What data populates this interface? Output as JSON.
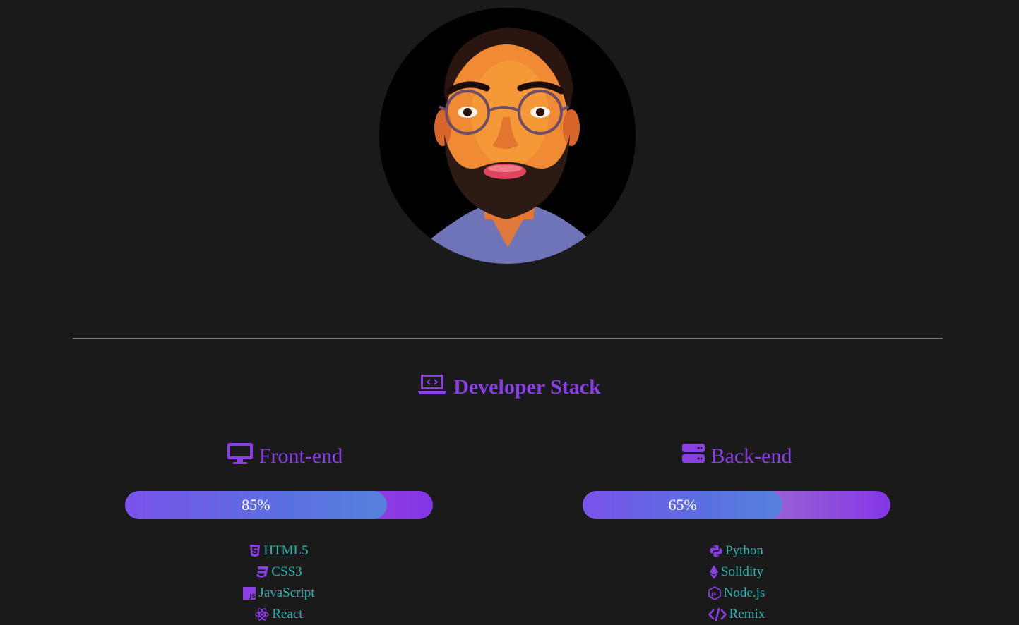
{
  "profile": {
    "avatar_alt": "profile-portrait"
  },
  "stack": {
    "title": "Developer Stack",
    "icon": "laptop-code-icon"
  },
  "frontend": {
    "title": "Front-end",
    "icon": "desktop-icon",
    "progress_value": 85,
    "progress_label": "85%",
    "skills": [
      {
        "label": "HTML5",
        "icon": "html5-icon"
      },
      {
        "label": "CSS3",
        "icon": "css3-icon"
      },
      {
        "label": "JavaScript",
        "icon": "js-icon"
      },
      {
        "label": "React",
        "icon": "react-icon"
      }
    ]
  },
  "backend": {
    "title": "Back-end",
    "icon": "server-icon",
    "progress_value": 65,
    "progress_label": "65%",
    "skills": [
      {
        "label": "Python",
        "icon": "python-icon"
      },
      {
        "label": "Solidity",
        "icon": "ethereum-icon"
      },
      {
        "label": "Node.js",
        "icon": "nodejs-icon"
      },
      {
        "label": "Remix",
        "icon": "code-icon"
      }
    ]
  },
  "colors": {
    "background": "#1a1a1a",
    "accent_purple": "#8a3fe6",
    "skill_text": "#27b5b1",
    "divider": "#7b63e0"
  }
}
